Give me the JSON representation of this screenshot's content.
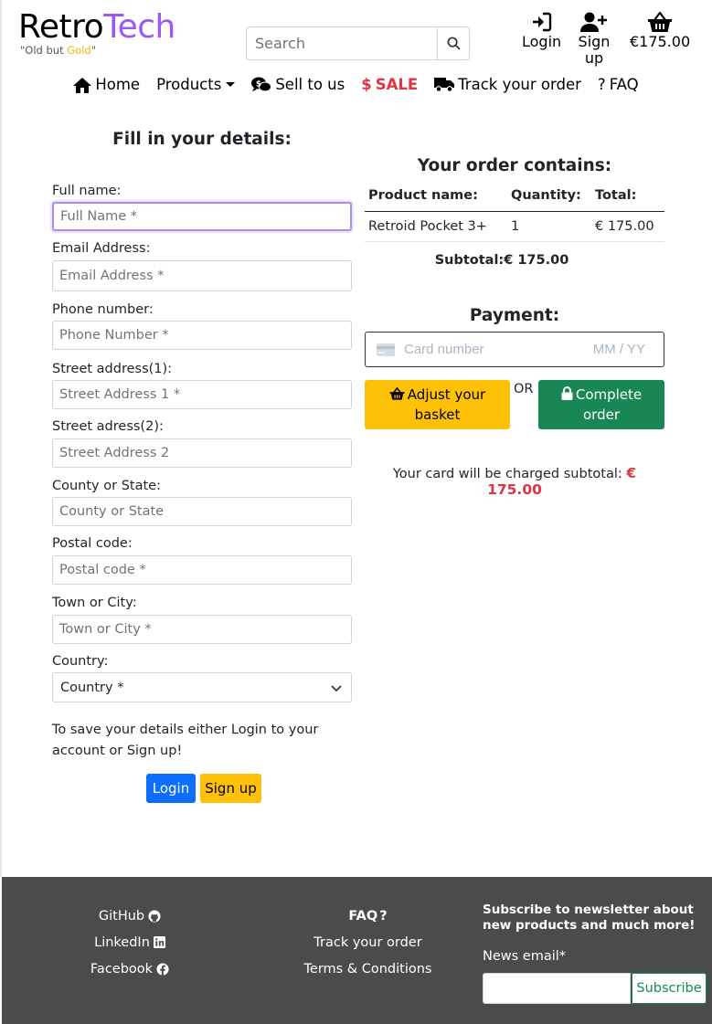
{
  "header": {
    "logo_part1": "Retro",
    "logo_part2": "Tech",
    "tagline_prefix": "\"Old but ",
    "tagline_gold": "Gold",
    "tagline_suffix": "\"",
    "search_placeholder": "Search",
    "login_label": "Login",
    "signup_label": "Sign up",
    "basket_total": "€175.00"
  },
  "nav": {
    "home": "Home",
    "products": "Products",
    "sell": "Sell to us",
    "sale": "SALE",
    "track": "Track your order",
    "faq": "FAQ"
  },
  "form": {
    "title": "Fill in your details:",
    "fields": [
      {
        "label": "Full name:",
        "placeholder": "Full Name *"
      },
      {
        "label": "Email Address:",
        "placeholder": "Email Address *"
      },
      {
        "label": "Phone number:",
        "placeholder": "Phone Number *"
      },
      {
        "label": "Street address(1):",
        "placeholder": "Street Address 1 *"
      },
      {
        "label": "Street adress(2):",
        "placeholder": "Street Address 2"
      },
      {
        "label": "County or State:",
        "placeholder": "County or State"
      },
      {
        "label": "Postal code:",
        "placeholder": "Postal code *"
      },
      {
        "label": "Town or City:",
        "placeholder": "Town or City *"
      }
    ],
    "country_label": "Country:",
    "country_value": "Country *",
    "save_text": "To save your details either Login to your account or Sign up!",
    "login_button": "Login",
    "signup_button": "Sign up"
  },
  "order": {
    "title": "Your order contains:",
    "columns": [
      "Product name:",
      "Quantity:",
      "Total:"
    ],
    "rows": [
      {
        "product": "Retroid Pocket 3+",
        "quantity": "1",
        "total": "€ 175.00"
      }
    ],
    "subtotal": "Subtotal:€ 175.00"
  },
  "payment": {
    "title": "Payment:",
    "card_placeholder": "Card number",
    "expiry_placeholder": "MM / YY",
    "adjust_button": "Adjust your basket",
    "or_text": "OR",
    "complete_button": "Complete order",
    "charge_text": "Your card will be charged subtotal: ",
    "charge_amount": "€ 175.00"
  },
  "footer": {
    "github": "GitHub",
    "linkedin": "LinkedIn",
    "facebook": "Facebook",
    "faq": "FAQ",
    "track": "Track your order",
    "terms": "Terms & Conditions",
    "newsletter_title": "Subscribe to newsletter about new products and much more!",
    "news_label": "News email*",
    "subscribe_button": "Subscribe"
  },
  "colors": {
    "brand_purple": "#9b59f4",
    "gold": "#f2b705",
    "sale_red": "#dc3545",
    "primary_blue": "#0d6efd",
    "warning_yellow": "#ffc107",
    "success_green": "#198754",
    "footer_bg": "#4a4b4c"
  }
}
